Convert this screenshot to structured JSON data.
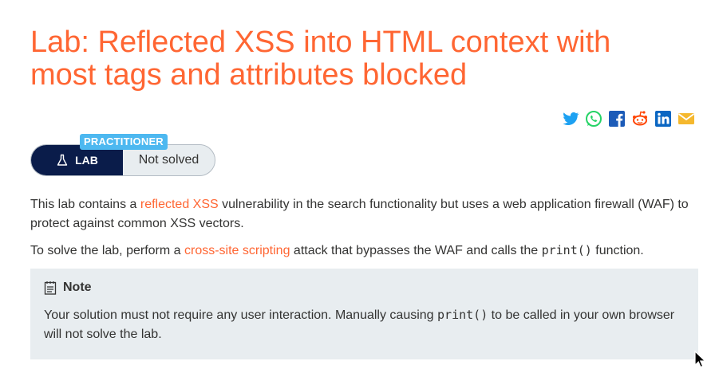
{
  "title": "Lab: Reflected XSS into HTML context with most tags and attributes blocked",
  "share_icons": [
    "twitter-icon",
    "whatsapp-icon",
    "facebook-icon",
    "reddit-icon",
    "linkedin-icon",
    "email-icon"
  ],
  "badge": {
    "level": "PRACTITIONER",
    "lab_label": "LAB",
    "status": "Not solved"
  },
  "description": {
    "p1_before": "This lab contains a ",
    "p1_link": "reflected XSS",
    "p1_after": " vulnerability in the search functionality but uses a web application firewall (WAF) to protect against common XSS vectors.",
    "p2_before": "To solve the lab, perform a ",
    "p2_link": "cross-site scripting",
    "p2_middle": " attack that bypasses the WAF and calls the ",
    "p2_code": "print()",
    "p2_after": " function."
  },
  "note": {
    "title": "Note",
    "body_before": "Your solution must not require any user interaction. Manually causing ",
    "body_code": "print()",
    "body_after": " to be called in your own browser will not solve the lab."
  },
  "colors": {
    "accent": "#ff6633",
    "lab_dark": "#0a1c4a",
    "level_blue": "#4db8f0",
    "note_bg": "#e8edf0"
  }
}
